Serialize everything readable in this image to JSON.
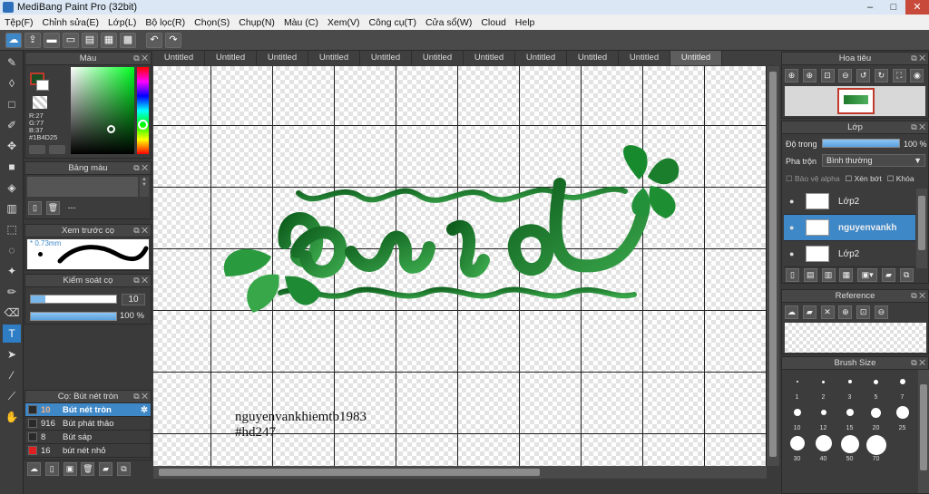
{
  "window": {
    "title": "MediBang Paint Pro (32bit)",
    "min": "–",
    "max": "□",
    "close": "✕"
  },
  "menu": [
    "Tệp(F)",
    "Chỉnh sửa(E)",
    "Lớp(L)",
    "Bộ lọc(R)",
    "Chọn(S)",
    "Chụp(N)",
    "Màu (C)",
    "Xem(V)",
    "Công cụ(T)",
    "Cửa sổ(W)",
    "Cloud",
    "Help"
  ],
  "tabs": [
    "Untitled",
    "Untitled",
    "Untitled",
    "Untitled",
    "Untitled",
    "Untitled",
    "Untitled",
    "Untitled",
    "Untitled",
    "Untitled",
    "Untitled"
  ],
  "color_panel": {
    "title": "Màu",
    "r": "R:27",
    "g": "G:77",
    "b": "B:37",
    "hex": "#1B4D25",
    "accent": "#1B4D25"
  },
  "palette_panel": {
    "title": "Bảng màu",
    "dash": "---"
  },
  "preview_panel": {
    "title": "Xem trước cọ",
    "size": "0.73mm"
  },
  "brush_ctrl": {
    "title": "Kiểm soát cọ",
    "size": "10",
    "opacity": "100 %"
  },
  "brush_list": {
    "title": "Cọ: Bút nét tròn",
    "items": [
      {
        "size": "10",
        "name": "Bút nét tròn",
        "color": "#2a2a2a",
        "selected": true
      },
      {
        "size": "916",
        "name": "Bút phát thảo",
        "color": "#2a2a2a",
        "selected": false
      },
      {
        "size": "8",
        "name": "Bút sáp",
        "color": "#2a2a2a",
        "selected": false
      },
      {
        "size": "16",
        "name": "bút nét nhỏ",
        "color": "#e02020",
        "selected": false
      }
    ]
  },
  "canvas": {
    "signature": "nguyenvankhiemtb1983",
    "tag": "#hd247",
    "accent": "#1e7a2c"
  },
  "navigator": {
    "title": "Hoa tiêu"
  },
  "layer_panel": {
    "title": "Lớp",
    "opacity_label": "Độ trong",
    "opacity_value": "100 %",
    "blend_label": "Pha trộn",
    "blend_value": "Bình thường",
    "protect_alpha": "Bảo vệ alpha",
    "clip": "Xén bớt",
    "lock": "Khóa",
    "layers": [
      {
        "name": "Lớp2",
        "selected": false
      },
      {
        "name": "nguyenvankh",
        "selected": true
      },
      {
        "name": "Lớp2",
        "selected": false
      }
    ]
  },
  "reference_panel": {
    "title": "Reference"
  },
  "brush_size_panel": {
    "title": "Brush Size",
    "sizes": [
      "1",
      "2",
      "3",
      "5",
      "7",
      "10",
      "12",
      "15",
      "20",
      "25",
      "30",
      "40",
      "50",
      "70"
    ]
  }
}
